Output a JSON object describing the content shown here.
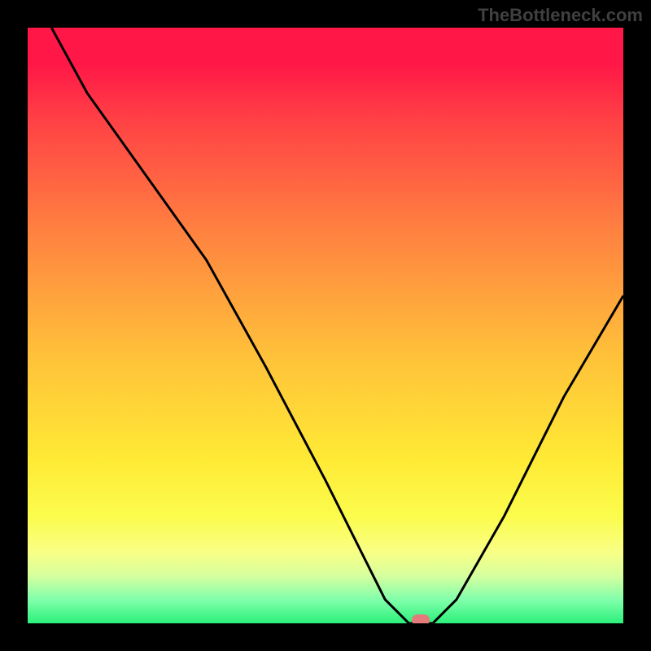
{
  "watermark": "TheBottleneck.com",
  "chart_data": {
    "type": "line",
    "title": "",
    "xlabel": "",
    "ylabel": "",
    "xlim": [
      0,
      100
    ],
    "ylim": [
      0,
      100
    ],
    "x": [
      4,
      10,
      20,
      30,
      40,
      50,
      56,
      60,
      64,
      68,
      72,
      80,
      90,
      100
    ],
    "values": [
      100,
      89,
      75,
      61,
      43,
      24,
      12,
      4,
      0,
      0,
      4,
      18,
      38,
      55
    ],
    "marker": {
      "x": 66,
      "y": 0
    },
    "background": "red-yellow-green vertical gradient"
  },
  "colors": {
    "curve": "#000000",
    "marker": "#e37b7b",
    "page_bg": "#000000"
  }
}
